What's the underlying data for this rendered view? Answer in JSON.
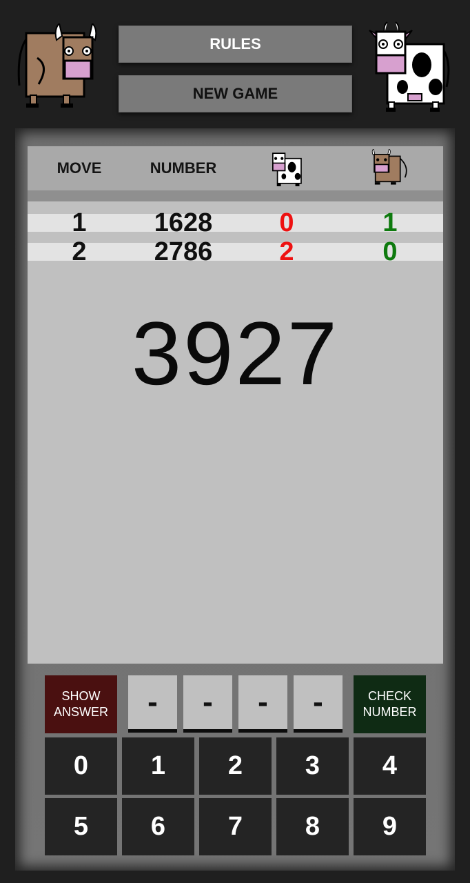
{
  "header": {
    "rules_label": "RULES",
    "new_game_label": "NEW GAME",
    "left_icon": "bull-icon",
    "right_icon": "cow-icon"
  },
  "table": {
    "columns": [
      "MOVE",
      "NUMBER",
      "cows",
      "bulls"
    ],
    "rows": [
      {
        "move": "1",
        "number": "1628",
        "cows": "0",
        "bulls": "1"
      },
      {
        "move": "2",
        "number": "2786",
        "cows": "2",
        "bulls": "0"
      }
    ]
  },
  "display": {
    "current_number": "3927"
  },
  "controls": {
    "show_answer_label": "SHOW\nANSWER",
    "check_number_label": "CHECK\nNUMBER",
    "slots": [
      "-",
      "-",
      "-",
      "-"
    ]
  },
  "keypad": [
    "0",
    "1",
    "2",
    "3",
    "4",
    "5",
    "6",
    "7",
    "8",
    "9"
  ],
  "colors": {
    "background": "#1f1f1f",
    "board": "#c0c0c0",
    "cows_value": "#ee1111",
    "bulls_value": "#0e7a0e",
    "show_answer_bg": "#4a1010",
    "check_number_bg": "#0f2b14",
    "key_bg": "#242424"
  }
}
